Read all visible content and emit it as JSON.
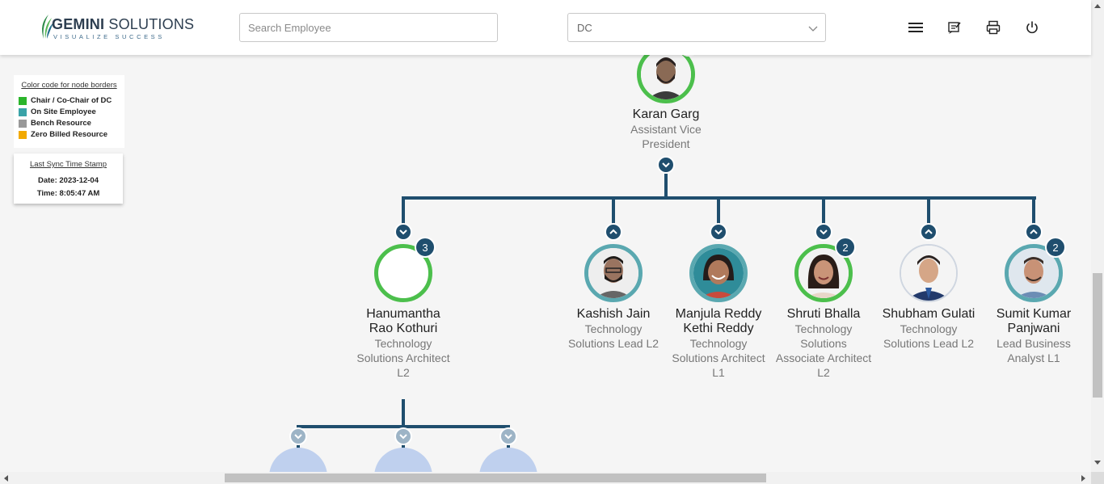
{
  "header": {
    "logo_brand": "GEMINI",
    "logo_suffix": " SOLUTIONS",
    "logo_tagline": "VISUALIZE SUCCESS",
    "search_placeholder": "Search Employee",
    "select_value": "DC",
    "icons": [
      "menu-icon",
      "notes-icon",
      "print-icon",
      "power-icon"
    ]
  },
  "legend": {
    "title": "Color code for node borders",
    "items": [
      {
        "label": "Chair / Co-Chair of DC",
        "color": "#2bb52b"
      },
      {
        "label": "On Site Employee",
        "color": "#3aa3a8"
      },
      {
        "label": "Bench Resource",
        "color": "#999999"
      },
      {
        "label": "Zero Billed Resource",
        "color": "#f2a900"
      }
    ]
  },
  "sync": {
    "title": "Last Sync Time Stamp",
    "date": "Date: 2023-12-04",
    "time": "Time: 8:05:47 AM"
  },
  "root": {
    "name": "Karan Garg",
    "role_line1": "Assistant Vice",
    "role_line2": "President"
  },
  "children": [
    {
      "name_line1": "Hanumantha",
      "name_line2": "Rao Kothuri",
      "role_lines": [
        "Technology",
        "Solutions Architect",
        "L2"
      ],
      "badge": "3",
      "border": "chair",
      "expanded": true
    },
    {
      "name_line1": "Kashish Jain",
      "name_line2": "",
      "role_lines": [
        "Technology",
        "Solutions Lead L2"
      ],
      "badge": "",
      "border": "onsite",
      "expanded": false
    },
    {
      "name_line1": "Manjula Reddy",
      "name_line2": "Kethi Reddy",
      "role_lines": [
        "Technology",
        "Solutions Architect",
        "L1"
      ],
      "badge": "",
      "border": "onsite",
      "expanded": true
    },
    {
      "name_line1": "Shruti Bhalla",
      "name_line2": "",
      "role_lines": [
        "Technology",
        "Solutions",
        "Associate Architect",
        "L2"
      ],
      "badge": "2",
      "border": "chair",
      "expanded": true
    },
    {
      "name_line1": "Shubham Gulati",
      "name_line2": "",
      "role_lines": [
        "Technology",
        "Solutions Lead L2"
      ],
      "badge": "",
      "border": "none",
      "expanded": false
    },
    {
      "name_line1": "Sumit Kumar",
      "name_line2": "Panjwani",
      "role_lines": [
        "Lead Business",
        "Analyst L1"
      ],
      "badge": "2",
      "border": "onsite",
      "expanded": false
    }
  ]
}
